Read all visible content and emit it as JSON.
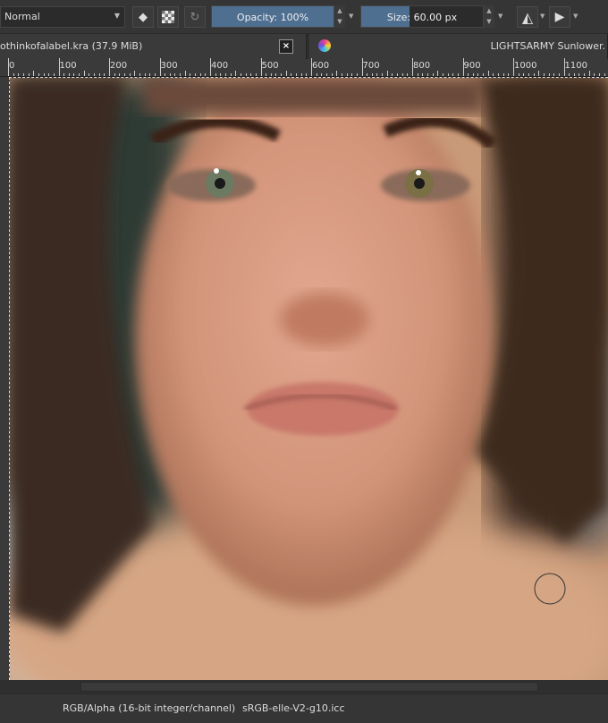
{
  "toolbar": {
    "blend_mode": "Normal",
    "opacity_label": "Opacity:  100%",
    "opacity_percent": 100,
    "size_label": "Size:  60.00 px",
    "size_fill_percent": 36
  },
  "tabs": {
    "document": "othinkofalabel.kra (37.9 MiB)",
    "close": "×",
    "brush_preset": "LIGHTSARMY Sunlower."
  },
  "ruler": {
    "ticks": [
      "0",
      "100",
      "200",
      "300",
      "400",
      "500",
      "600",
      "700",
      "800",
      "900",
      "1000",
      "1100"
    ]
  },
  "status": {
    "color_space": "RGB/Alpha (16-bit integer/channel)",
    "profile": "sRGB-elle-V2-g10.icc"
  }
}
